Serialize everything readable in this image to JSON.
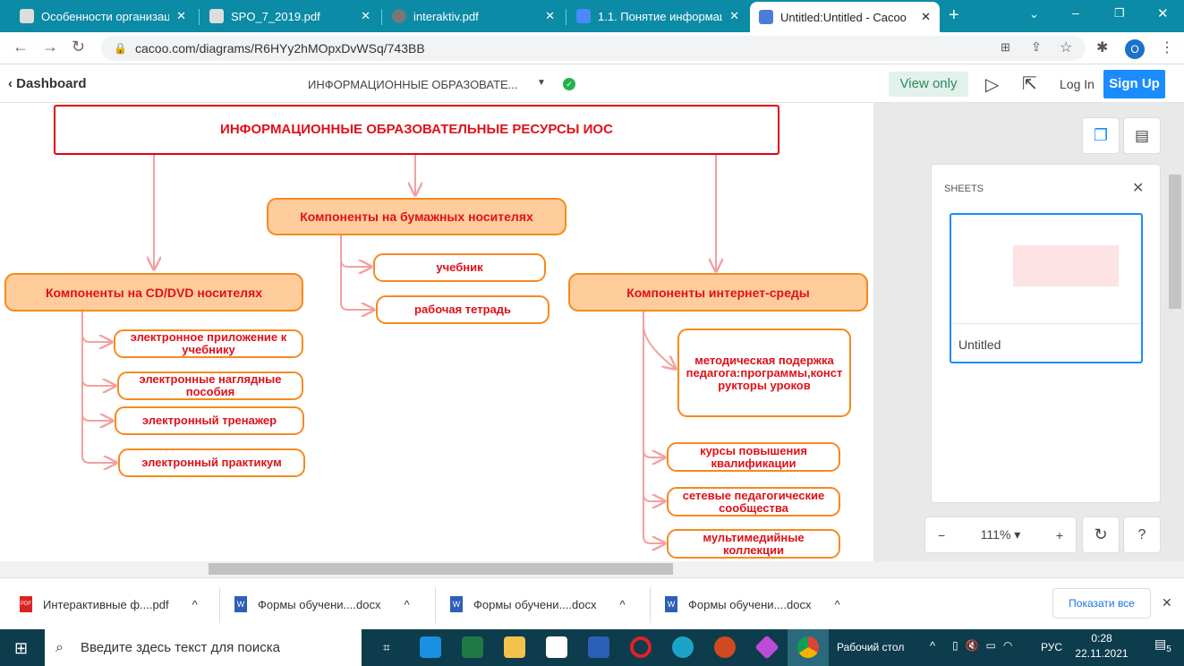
{
  "browser": {
    "tabs": [
      {
        "title": "Особенности организац"
      },
      {
        "title": "SPO_7_2019.pdf"
      },
      {
        "title": "interaktiv.pdf"
      },
      {
        "title": "1.1. Понятие информаци"
      },
      {
        "title": "Untitled:Untitled - Cacoo",
        "active": true
      }
    ],
    "url": "cacoo.com/diagrams/R6HYy2hMOpxDvWSq/743BB",
    "profile_initial": "O"
  },
  "app": {
    "back_label": "Dashboard",
    "doc_title": "ИНФОРМАЦИОННЫЕ ОБРАЗОВАТЕ...",
    "view_only": "View only",
    "login": "Log In",
    "signup": "Sign Up",
    "accent": "#1a8cff"
  },
  "diagram": {
    "title": "ИНФОРМАЦИОННЫЕ ОБРАЗОВАТЕЛЬНЫЕ РЕСУРСЫ  ИОС",
    "paper": {
      "label": "Компоненты на бумажных носителях",
      "children": [
        "учебник",
        "рабочая тетрадь"
      ]
    },
    "cd": {
      "label": "Компоненты на CD/DVD носителях",
      "children": [
        "электронное приложение к учебнику",
        "электронные наглядные пособия",
        "электронный тренажер",
        "электронный практикум"
      ]
    },
    "internet": {
      "label": "Компоненты интернет-среды",
      "children": [
        "методическая подержка педагога:программы,конст рукторы уроков",
        "курсы повышения квалификации",
        "сетевые педагогические сообщества",
        "мультимедийные коллекции"
      ]
    }
  },
  "sheets": {
    "heading": "SHEETS",
    "items": [
      {
        "name": "Untitled"
      }
    ]
  },
  "zoom": {
    "level": "111%"
  },
  "downloads": {
    "items": [
      "Интерактивные ф....pdf",
      "Формы обучени....docx",
      "Формы обучени....docx",
      "Формы обучени....docx"
    ],
    "show_all": "Показати все"
  },
  "taskbar": {
    "search_placeholder": "Введите здесь текст для поиска",
    "desktop": "Рабочий стол",
    "lang": "РУС",
    "time": "0:28",
    "date": "22.11.2021",
    "notifications": "5"
  }
}
